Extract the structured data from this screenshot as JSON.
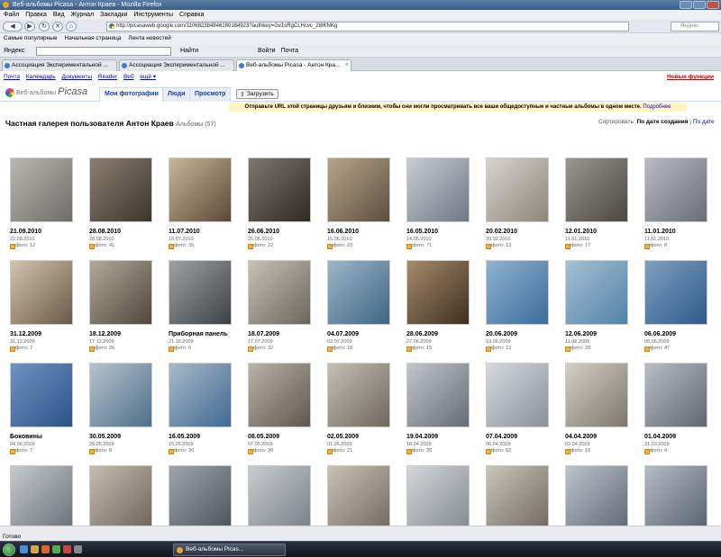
{
  "window": {
    "title": "Веб-альбомы Picasa - Антон Краев - Mozilla Firefox"
  },
  "menu": [
    "Файл",
    "Правка",
    "Вид",
    "Журнал",
    "Закладки",
    "Инструменты",
    "Справка"
  ],
  "nav": {
    "url": "http://picasaweb.google.com/110682384846180184923?authkey=Gv1sRgCLHcvc_28IKNKg",
    "search_placeholder": "Яндекс"
  },
  "bookmarks": [
    "Самые популярные",
    "Начальная страница",
    "Лента новостей"
  ],
  "yandex": {
    "label": "Яндекс",
    "find": "Найти",
    "login": "Войти",
    "mail": "Почта"
  },
  "tabs": [
    "Ассоциация Экспериментальной ...",
    "Ассоциация Экспериментальной ...",
    "Веб-альбомы Picasa - Антон Кра..."
  ],
  "gbar": {
    "links": [
      "Почта",
      "Календарь",
      "Документы",
      "Reader",
      "Веб",
      "ещё ▾"
    ],
    "new_features": "Новые функции"
  },
  "picasa": {
    "logo_small": "Веб-альбомы",
    "logo_big": "Picasa",
    "tabs": [
      "Мои фотографии",
      "Люди",
      "Просмотр"
    ],
    "upload": "Загрузить"
  },
  "notice": {
    "text": "Отправьте URL этой страницы друзьям и близким, чтобы они могли просматривать все ваши общедоступные и частные альбомы в одном месте.",
    "link": "Подробнее"
  },
  "gallery": {
    "title": "Частная галерея пользователя Антон Краев",
    "albums_count": "Альбомы (57)"
  },
  "sort": {
    "label": "Сортировать:",
    "by_date": "По дате создания",
    "separator": "|",
    "by_other": "По дате"
  },
  "albums": [
    {
      "title": "21.09.2010",
      "date": "22.09.2010",
      "photos": "фото: 12"
    },
    {
      "title": "28.08.2010",
      "date": "28.08.2010",
      "photos": "фото: 41"
    },
    {
      "title": "11.07.2010",
      "date": "10.07.2010",
      "photos": "фото: 35"
    },
    {
      "title": "26.06.2010",
      "date": "25.06.2010",
      "photos": "фото: 22"
    },
    {
      "title": "16.06.2010",
      "date": "15.06.2010",
      "photos": "фото: 23"
    },
    {
      "title": "16.05.2010",
      "date": "14.05.2010",
      "photos": "фото: 71"
    },
    {
      "title": "20.02.2010",
      "date": "20.02.2010",
      "photos": "фото: 13"
    },
    {
      "title": "12.01.2010",
      "date": "11.01.2010",
      "photos": "фото: 17"
    },
    {
      "title": "11.01.2010",
      "date": "11.01.2010",
      "photos": "фото: 8"
    },
    {
      "title": "31.12.2009",
      "date": "31.12.2009",
      "photos": "фото: 7"
    },
    {
      "title": "18.12.2009",
      "date": "17.12.2009",
      "photos": "фото: 26"
    },
    {
      "title": "Приборная панель",
      "date": "21.10.2009",
      "photos": "фото: 6"
    },
    {
      "title": "18.07.2009",
      "date": "17.07.2009",
      "photos": "фото: 32"
    },
    {
      "title": "04.07.2009",
      "date": "03.07.2009",
      "photos": "фото: 18"
    },
    {
      "title": "28.06.2009",
      "date": "27.06.2009",
      "photos": "фото: 15"
    },
    {
      "title": "20.06.2009",
      "date": "19.06.2009",
      "photos": "фото: 13"
    },
    {
      "title": "12.06.2009",
      "date": "11.06.2009",
      "photos": "фото: 28"
    },
    {
      "title": "06.06.2009",
      "date": "05.06.2009",
      "photos": "фото: 47"
    },
    {
      "title": "Боковины",
      "date": "04.06.2009",
      "photos": "фото: 7"
    },
    {
      "title": "30.05.2009",
      "date": "29.05.2009",
      "photos": "фото: 8"
    },
    {
      "title": "16.05.2009",
      "date": "15.05.2009",
      "photos": "фото: 30"
    },
    {
      "title": "08.05.2009",
      "date": "07.05.2009",
      "photos": "фото: 36"
    },
    {
      "title": "02.05.2009",
      "date": "01.05.2009",
      "photos": "фото: 21"
    },
    {
      "title": "19.04.2009",
      "date": "18.04.2009",
      "photos": "фото: 35"
    },
    {
      "title": "07.04.2009",
      "date": "06.04.2009",
      "photos": "фото: 52"
    },
    {
      "title": "04.04.2009",
      "date": "03.04.2009",
      "photos": "фото: 16"
    },
    {
      "title": "01.04.2009",
      "date": "31.03.2009",
      "photos": "фото: 4"
    },
    {
      "title": "",
      "date": "",
      "photos": ""
    },
    {
      "title": "",
      "date": "",
      "photos": ""
    },
    {
      "title": "",
      "date": "",
      "photos": ""
    },
    {
      "title": "",
      "date": "",
      "photos": ""
    },
    {
      "title": "",
      "date": "",
      "photos": ""
    },
    {
      "title": "",
      "date": "",
      "photos": ""
    },
    {
      "title": "",
      "date": "",
      "photos": ""
    },
    {
      "title": "",
      "date": "",
      "photos": ""
    },
    {
      "title": "",
      "date": "",
      "photos": ""
    }
  ],
  "status": "Готово",
  "taskbar": {
    "item": "Веб-альбомы Picas..."
  },
  "colors": {
    "link": "#0000cc",
    "accent": "#1a3cac",
    "notice_bg": "#fff4c2"
  }
}
